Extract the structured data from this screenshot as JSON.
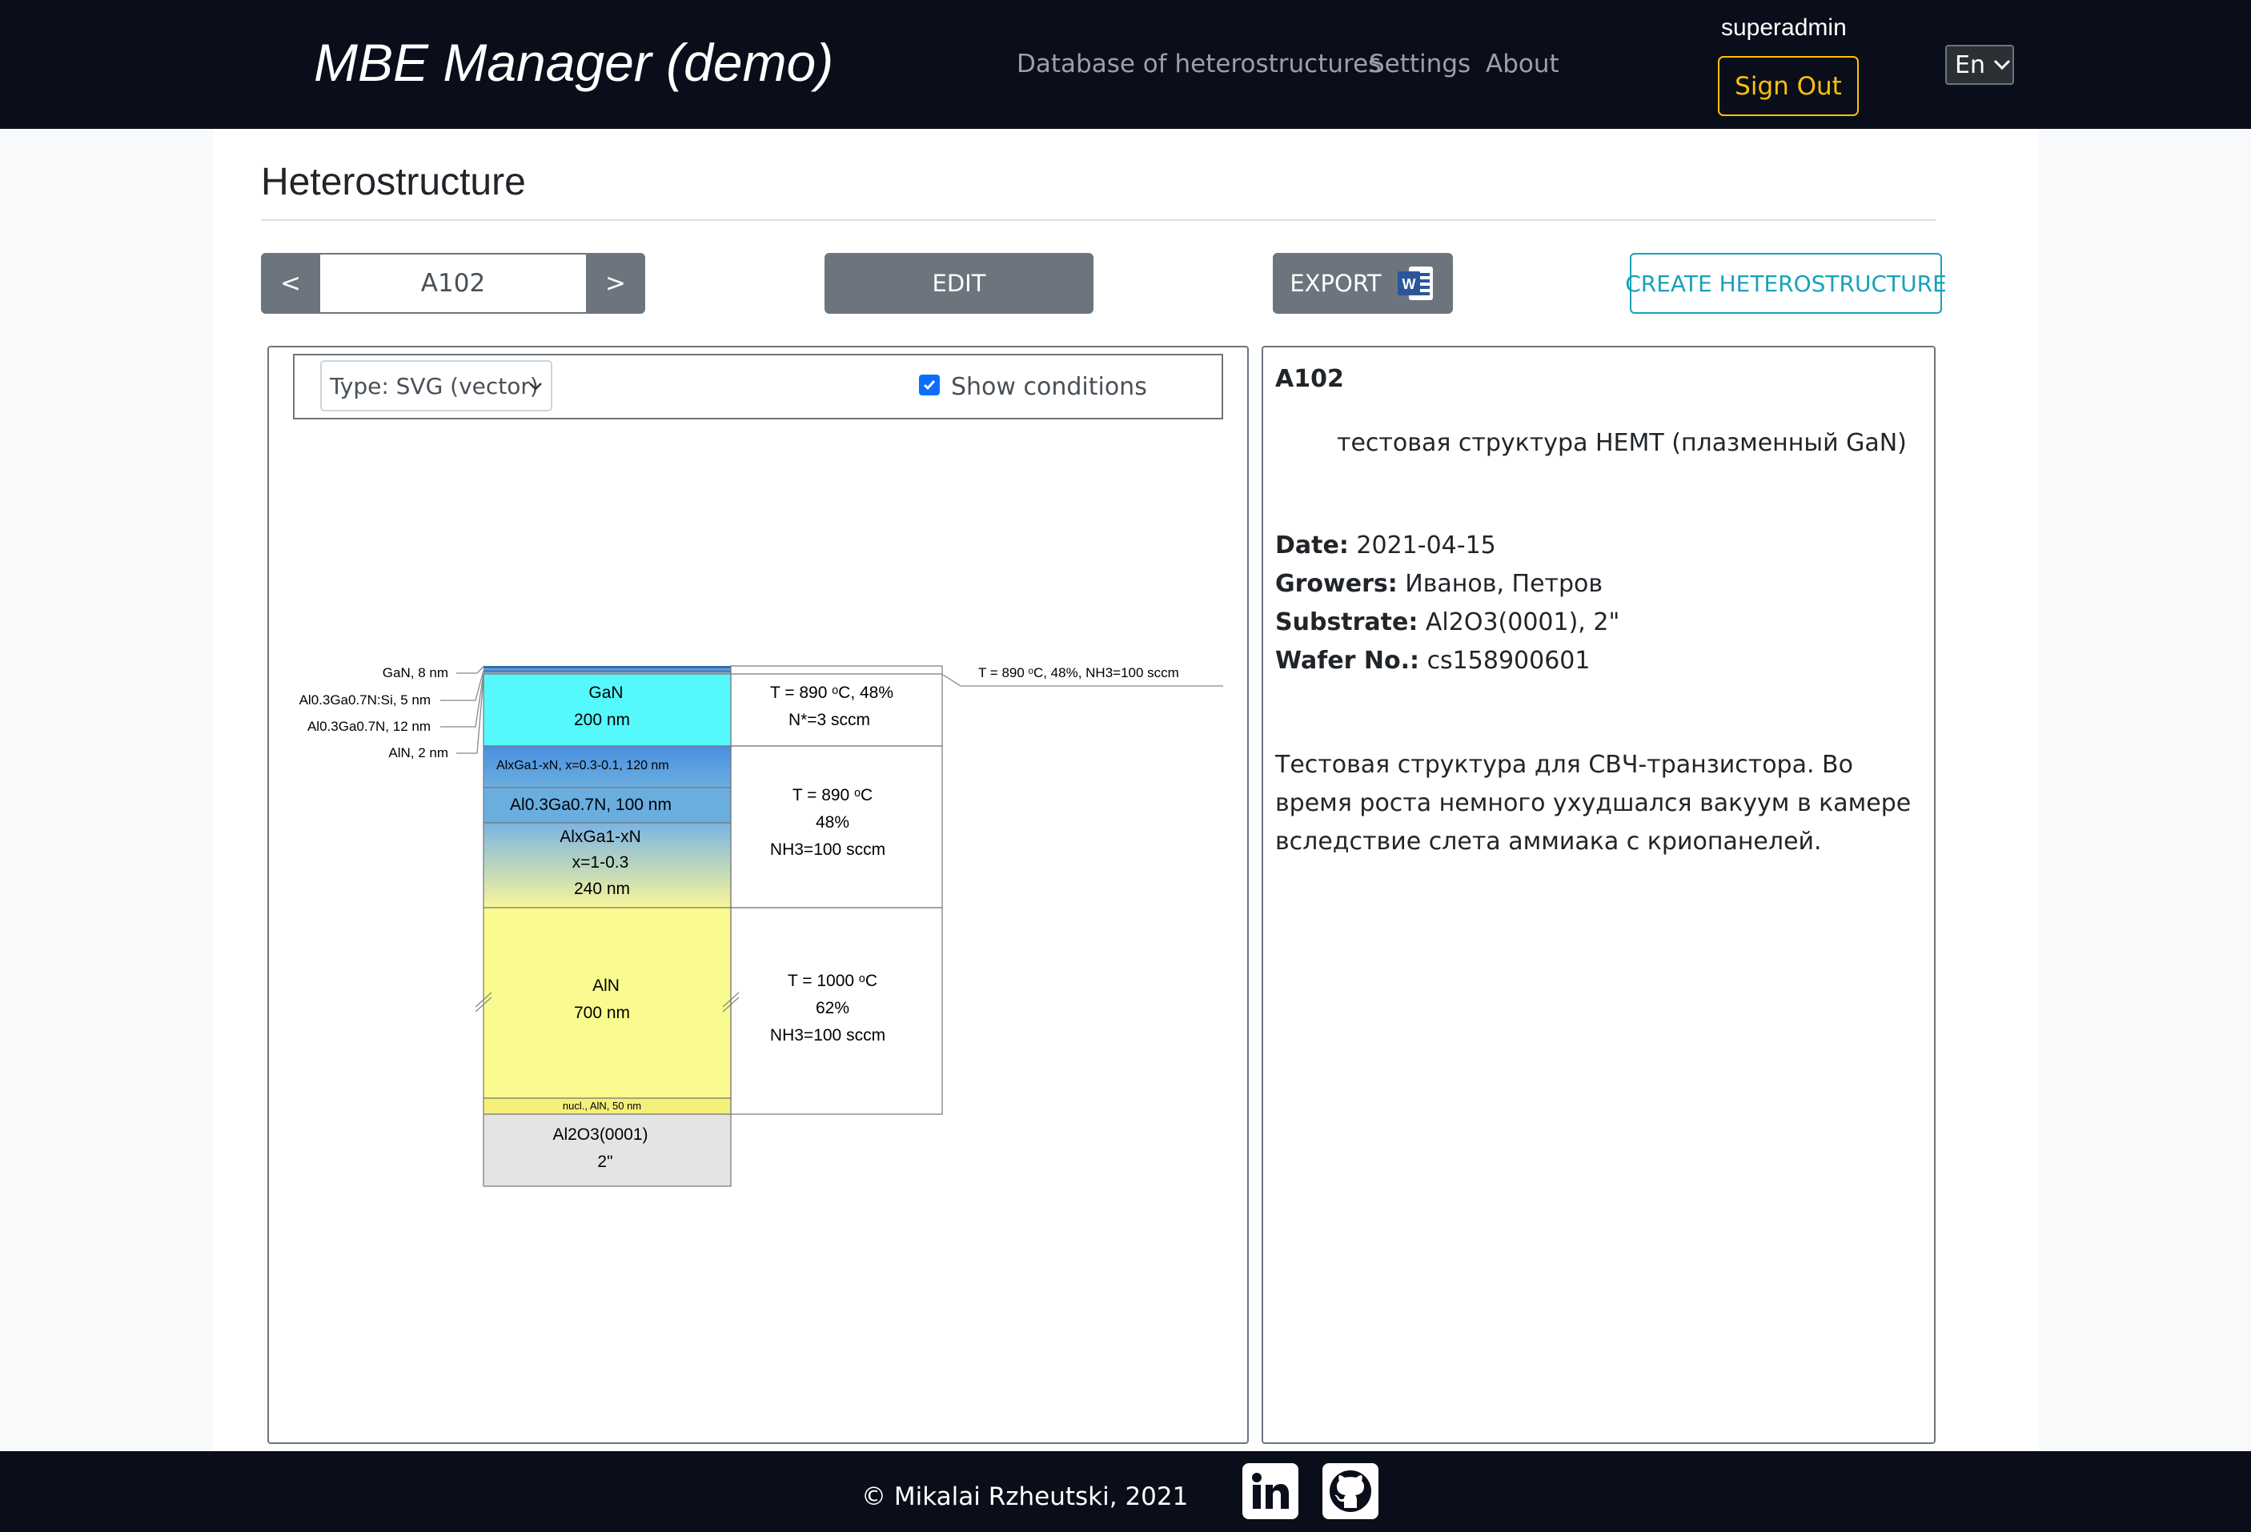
{
  "navbar": {
    "brand": "MBE Manager (demo)",
    "links": [
      "Database of heterostructures",
      "Settings",
      "About"
    ],
    "user": "superadmin",
    "sign_out": "Sign Out",
    "lang": "En",
    "bg_color": "#0a0e1a",
    "accent_color": "#ffc107"
  },
  "page": {
    "title": "Heterostructure",
    "prev": "<",
    "next": ">",
    "current": "A102",
    "edit": "EDIT",
    "export": "EXPORT",
    "export_icon": "word-icon",
    "create": "CREATE HETEROSTRUCTURE"
  },
  "controls": {
    "type_select": "Type: SVG (vector)",
    "show_conditions": "Show conditions",
    "show_conditions_checked": true
  },
  "details": {
    "name": "A102",
    "description": "тестовая структура HEMT (плазменный GaN)",
    "date_label": "Date:",
    "date": "2021-04-15",
    "growers_label": "Growers:",
    "growers": "Иванов, Петров",
    "substrate_label": "Substrate:",
    "substrate": "Al2O3(0001), 2\"",
    "wafer_label": "Wafer No.:",
    "wafer": "cs158900601",
    "notes": "Тестовая структура для СВЧ-транзистора. Во время роста немного ухудшался вакуум в камере вследствие слета аммиака с криопанелей."
  },
  "diagram": {
    "side_labels": [
      "GaN, 8 nm",
      "Al0.3Ga0.7N:Si, 5 nm",
      "Al0.3Ga0.7N, 12 nm",
      "AlN, 2 nm"
    ],
    "layers": {
      "gan_name": "GaN",
      "gan_thickness": "200 nm",
      "algan_grad_top": "AlxGa1-xN, x=0.3-0.1, 120 nm",
      "algan_100": "Al0.3Ga0.7N, 100 nm",
      "algan_grad_name": "AlxGa1-xN",
      "algan_grad_x": "x=1-0.3",
      "algan_grad_thickness": "240 nm",
      "aln_name": "AlN",
      "aln_thickness": "700 nm",
      "nucl": "nucl., AlN, 50 nm",
      "substrate_name": "Al2O3(0001)",
      "substrate_size": "2\""
    },
    "conditions": {
      "top": "T = 890  ᵒC, 48%, NH3=100 sccm",
      "c1_line1": "T = 890  ᵒC, 48%",
      "c1_line2": "N*=3 sccm",
      "c2_line1": "T = 890  ᵒC",
      "c2_line2": "48%",
      "c2_line3": "NH3=100 sccm",
      "c3_line1": "T = 1000  ᵒC",
      "c3_line2": "62%",
      "c3_line3": "NH3=100 sccm"
    }
  },
  "footer": {
    "copyright": "© Mikalai Rzheutski, 2021",
    "social": [
      "linkedin-icon",
      "github-icon"
    ]
  }
}
